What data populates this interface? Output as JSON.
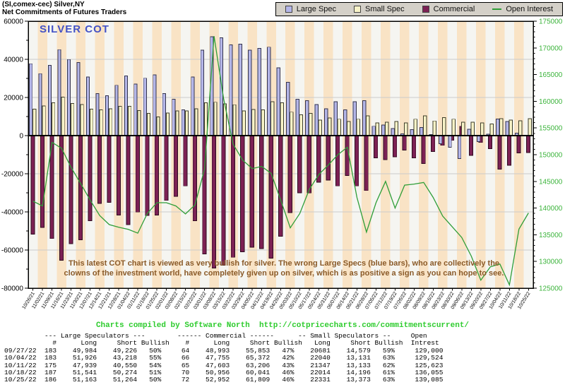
{
  "header": {
    "title_line1": "(SI,comex-cec) Silver,NY",
    "title_line2": "Net Commitments of Futures Traders"
  },
  "legend": {
    "items": [
      {
        "label": "Large Spec",
        "color": "#b4b6e8"
      },
      {
        "label": "Small Spec",
        "color": "#f8f3c8"
      },
      {
        "label": "Commercial",
        "color": "#7c2154"
      },
      {
        "label": "Open Interest",
        "color": "#2f9e38"
      }
    ]
  },
  "watermark": "SILVER COT",
  "annotation": {
    "line1": "This latest COT chart is viewed as very bullish for silver. The wrong Large Specs  (blue bars), who are collectively the",
    "line2": "clowns of the investment world, have completely given up on silver, which is as positive a sign as you can hope to see.",
    "color": "#8a5a28"
  },
  "credits": {
    "text": "Charts compiled by Software North",
    "url": "http://cotpricecharts.com/commitmentscurrent/"
  },
  "chart_data": {
    "type": "bar",
    "subtype": "grouped-bars-with-line-overlay",
    "x": [
      "10/26/21",
      "11/02/21",
      "11/09/21",
      "11/16/21",
      "11/23/21",
      "11/30/21",
      "12/07/21",
      "12/14/21",
      "12/21/21",
      "12/28/21",
      "01/04/22",
      "01/11/22",
      "01/18/22",
      "01/25/22",
      "02/01/22",
      "02/08/22",
      "02/15/22",
      "02/22/22",
      "03/01/22",
      "03/08/22",
      "03/15/22",
      "03/22/22",
      "03/29/22",
      "04/05/22",
      "04/12/22",
      "04/19/22",
      "04/26/22",
      "05/03/22",
      "05/10/22",
      "05/17/22",
      "05/24/22",
      "05/31/22",
      "06/07/22",
      "06/14/22",
      "06/21/22",
      "06/28/22",
      "07/05/22",
      "07/12/22",
      "07/19/22",
      "07/26/22",
      "08/02/22",
      "08/09/22",
      "08/16/22",
      "08/23/22",
      "08/30/22",
      "09/06/22",
      "09/13/22",
      "09/20/22",
      "09/27/22",
      "10/04/22",
      "10/11/22",
      "10/18/22",
      "10/25/22"
    ],
    "series": [
      {
        "name": "Large Spec",
        "type": "bar",
        "axis": "left",
        "color": "#b4b6e8",
        "stroke": "#33334d",
        "values": [
          37700,
          32500,
          36800,
          45100,
          39900,
          38300,
          30700,
          22100,
          20900,
          26400,
          31300,
          27000,
          30100,
          31900,
          22100,
          19000,
          13500,
          30700,
          44800,
          51900,
          51300,
          47600,
          48000,
          44800,
          45800,
          46400,
          35600,
          28000,
          19000,
          18400,
          16300,
          14100,
          17800,
          13500,
          17800,
          18400,
          4900,
          5500,
          3700,
          860,
          3100,
          4300,
          600,
          -4300,
          -6100,
          -12000,
          3300,
          -3100,
          758,
          8708,
          7389,
          1267,
          -101
        ]
      },
      {
        "name": "Small Spec",
        "type": "bar",
        "axis": "left",
        "color": "#f8f3c8",
        "stroke": "#3d3d2a",
        "values": [
          13900,
          15600,
          17200,
          20200,
          16800,
          16300,
          13900,
          13500,
          14100,
          15300,
          15300,
          13100,
          11700,
          9800,
          11900,
          12900,
          12900,
          14000,
          17200,
          17500,
          16600,
          16200,
          12900,
          13700,
          13500,
          17800,
          17200,
          12300,
          11000,
          11700,
          8200,
          9200,
          8600,
          7400,
          8600,
          10400,
          6700,
          7100,
          7400,
          6700,
          8600,
          10400,
          7700,
          9400,
          8600,
          7100,
          7100,
          6700,
          6102,
          8909,
          8214,
          7818,
          8958
        ]
      },
      {
        "name": "Commercial",
        "type": "bar",
        "axis": "left",
        "color": "#7c2154",
        "stroke": "#2e0c20",
        "values": [
          -51600,
          -48100,
          -54000,
          -65300,
          -56700,
          -54600,
          -44600,
          -35600,
          -35000,
          -41700,
          -46600,
          -40100,
          -41800,
          -41700,
          -34000,
          -31900,
          -26400,
          -44700,
          -62000,
          -69400,
          -67900,
          -63800,
          -60900,
          -58500,
          -59300,
          -64200,
          -52800,
          -40300,
          -30000,
          -30100,
          -24500,
          -23300,
          -26400,
          -20900,
          -26400,
          -28800,
          -11600,
          -12600,
          -11100,
          -7560,
          -11700,
          -14700,
          -8300,
          -5100,
          -2500,
          4900,
          -10400,
          -3600,
          -6860,
          -17617,
          -15603,
          -9085,
          -8857
        ]
      },
      {
        "name": "Open Interest",
        "type": "line",
        "axis": "right",
        "color": "#2f9e38",
        "values": [
          141300,
          140400,
          152300,
          151200,
          147600,
          144600,
          141500,
          138600,
          136900,
          136400,
          136000,
          135300,
          139000,
          141000,
          141000,
          140400,
          138900,
          140600,
          147300,
          172200,
          160500,
          152000,
          149000,
          147400,
          147800,
          146500,
          141500,
          136300,
          139000,
          143500,
          146300,
          148100,
          150000,
          151400,
          142000,
          135500,
          141000,
          145000,
          140000,
          144300,
          144500,
          144800,
          142000,
          138500,
          136500,
          134500,
          131000,
          126500,
          129000,
          129524,
          125623,
          136055,
          139085
        ]
      }
    ],
    "left_axis": {
      "min": -80000,
      "max": 60000,
      "tick_step": 20000,
      "minor_step": 10000,
      "labels": [
        "60000",
        "40000",
        "20000",
        "0",
        "-20000",
        "-40000",
        "-60000",
        "-80000"
      ]
    },
    "right_axis": {
      "min": 125000,
      "max": 175000,
      "tick_step": 5000,
      "minor_step": 1000,
      "labels": [
        "175000",
        "170000",
        "165000",
        "160000",
        "155000",
        "150000",
        "145000",
        "140000",
        "135000",
        "130000",
        "125000"
      ],
      "label_color": "#3cb43c"
    },
    "plot_bg_stripe_colors": [
      "#f5f5f1",
      "#f9e3c5"
    ],
    "gridline_color": "#cbcbcb",
    "legend_position": "top-right",
    "grid": true
  },
  "table": {
    "header_line1": "          --- Large Speculators ---        ------ Commercial ------      -- Small Speculators --     Open",
    "header_line2": "            #      Long     Short Bullish    #      Long     Short Bullish   Long     Short Bullish  Intrest",
    "rows": [
      {
        "date": "09/27/22",
        "ls_n": "183",
        "ls_long": "49,984",
        "ls_short": "49,226",
        "ls_bull": "50%",
        "c_n": "64",
        "c_long": "48,993",
        "c_short": "55,853",
        "c_bull": "47%",
        "ss_long": "20681",
        "ss_short": "14,579",
        "ss_bull": "59%",
        "oi": "129,000"
      },
      {
        "date": "10/04/22",
        "ls_n": "183",
        "ls_long": "51,926",
        "ls_short": "43,218",
        "ls_bull": "55%",
        "c_n": "66",
        "c_long": "47,755",
        "c_short": "65,372",
        "c_bull": "42%",
        "ss_long": "22040",
        "ss_short": "13,131",
        "ss_bull": "63%",
        "oi": "129,524"
      },
      {
        "date": "10/11/22",
        "ls_n": "175",
        "ls_long": "47,939",
        "ls_short": "40,550",
        "ls_bull": "54%",
        "c_n": "65",
        "c_long": "47,603",
        "c_short": "63,206",
        "c_bull": "43%",
        "ss_long": "21347",
        "ss_short": "13,133",
        "ss_bull": "62%",
        "oi": "125,623"
      },
      {
        "date": "10/18/22",
        "ls_n": "187",
        "ls_long": "51,541",
        "ls_short": "50,274",
        "ls_bull": "51%",
        "c_n": "70",
        "c_long": "50,956",
        "c_short": "60,041",
        "c_bull": "46%",
        "ss_long": "22014",
        "ss_short": "14,196",
        "ss_bull": "61%",
        "oi": "136,055"
      },
      {
        "date": "10/25/22",
        "ls_n": "186",
        "ls_long": "51,163",
        "ls_short": "51,264",
        "ls_bull": "50%",
        "c_n": "72",
        "c_long": "52,952",
        "c_short": "61,809",
        "c_bull": "46%",
        "ss_long": "22331",
        "ss_short": "13,373",
        "ss_bull": "63%",
        "oi": "139,085"
      }
    ]
  }
}
